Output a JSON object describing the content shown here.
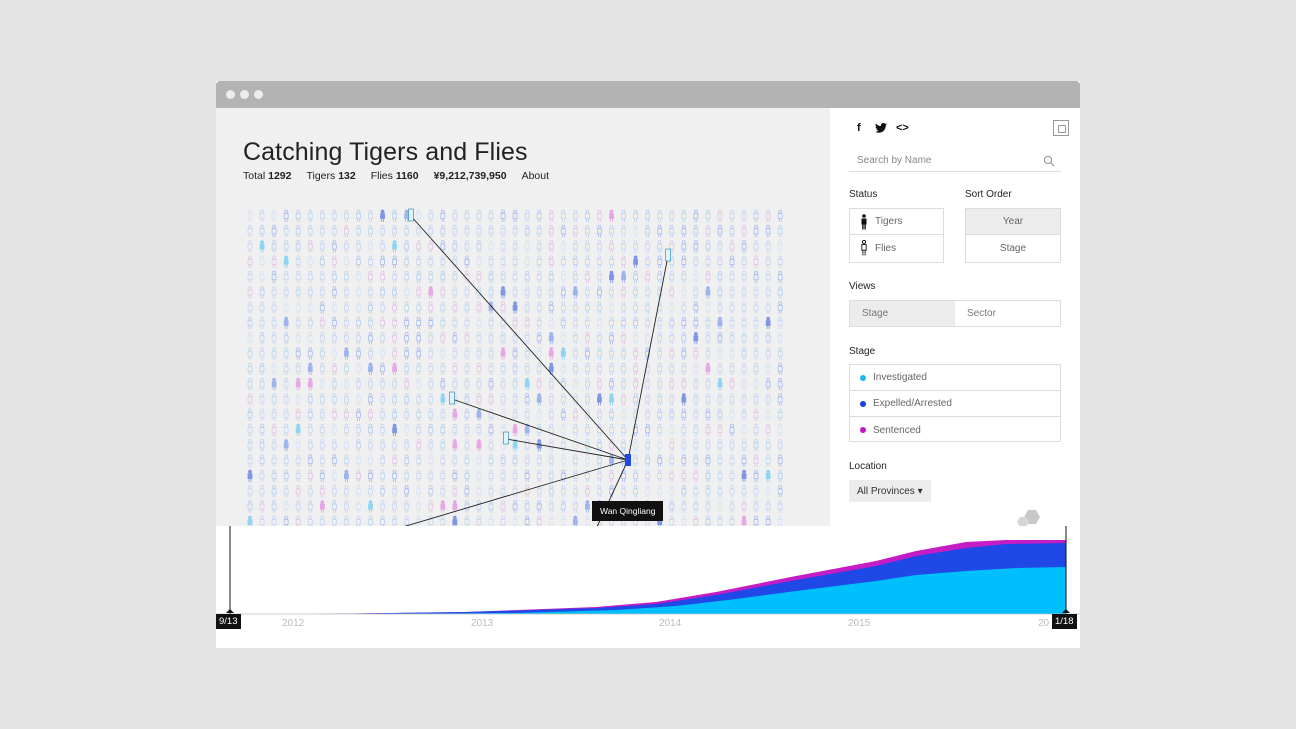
{
  "header": {
    "title": "Catching Tigers and Flies",
    "stats": [
      {
        "label": "Total",
        "value": "1292"
      },
      {
        "label": "Tigers",
        "value": "132"
      },
      {
        "label": "Flies",
        "value": "1160"
      },
      {
        "label": "",
        "value": "¥9,212,739,950"
      },
      {
        "label": "About",
        "value": ""
      }
    ]
  },
  "tooltip": {
    "name": "Wan Qingliang"
  },
  "social": {
    "facebook": "f",
    "embed": "<>"
  },
  "sidebar": {
    "search_placeholder": "Search by Name",
    "status": {
      "label": "Status",
      "tigers": "Tigers",
      "flies": "Flies"
    },
    "sort": {
      "label": "Sort Order",
      "year": "Year",
      "stage": "Stage"
    },
    "views": {
      "label": "Views",
      "stage": "Stage",
      "sector": "Sector"
    },
    "stage": {
      "label": "Stage",
      "items": [
        {
          "label": "Investigated",
          "color": "#1ab8f0"
        },
        {
          "label": "Expelled/Arrested",
          "color": "#1a3fe0"
        },
        {
          "label": "Sentenced",
          "color": "#c218c2"
        }
      ]
    },
    "location": {
      "label": "Location",
      "value": "All Provinces ▾"
    }
  },
  "timeline": {
    "start_marker": "9/13",
    "end_marker": "1/18",
    "years": [
      "2012",
      "2013",
      "2014",
      "2015",
      "20"
    ]
  },
  "colors": {
    "investigated": "#00bfff",
    "expelled": "#1f48e6",
    "sentenced": "#c51cc5"
  }
}
